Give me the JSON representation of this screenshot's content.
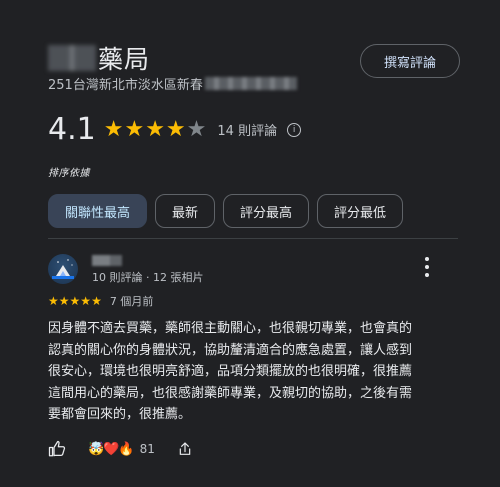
{
  "place": {
    "name": "藥局",
    "address": "251台灣新北市淡水區新春"
  },
  "header": {
    "write_review_label": "撰寫評論"
  },
  "rating": {
    "score": "4.1",
    "stars_value": 4.1,
    "stars_max": 5,
    "review_count_label": "14 則評論"
  },
  "search_label": "排序依據",
  "sort_chips": [
    {
      "label": "關聯性最高",
      "active": true
    },
    {
      "label": "最新",
      "active": false
    },
    {
      "label": "評分最高",
      "active": false
    },
    {
      "label": "評分最低",
      "active": false
    }
  ],
  "review": {
    "author_meta": "10 則評論 · 12 張相片",
    "stars": 5,
    "time": "7 個月前",
    "text": "因身體不適去買藥，藥師很主動關心，也很親切專業，也會真的\n認真的關心你的身體狀況，協助釐清適合的應急處置，讓人感到\n很安心，環境也很明亮舒適，品項分類擺放的也很明確，很推薦\n這間用心的藥局，也很感謝藥師專業，及親切的協助，之後有需\n要都會回來的，很推薦。",
    "reaction_count": "81"
  },
  "colors": {
    "background": "#202124",
    "star_on": "#fbbc04",
    "star_off": "#80868b",
    "chip_active_bg": "#394457"
  },
  "icons": {
    "info": "info-icon",
    "more": "more-vert-icon",
    "like": "thumb-up-icon",
    "share": "share-icon"
  }
}
